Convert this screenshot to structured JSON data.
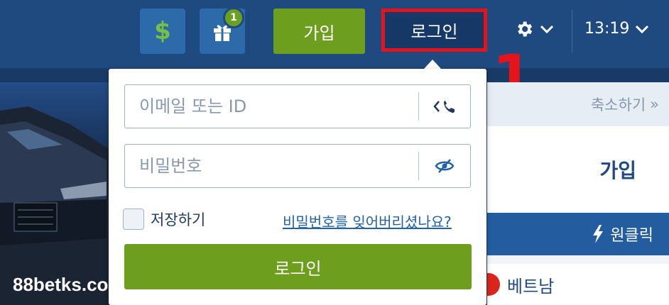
{
  "header": {
    "gift_badge_count": "1",
    "join_label": "가입",
    "login_label": "로그인",
    "time": "13:19",
    "annotation_marker": "1"
  },
  "login_form": {
    "email_placeholder": "이메일 또는 ID",
    "email_value": "",
    "password_placeholder": "비밀번호",
    "password_value": "",
    "remember_label": "저장하기",
    "remember_checked": false,
    "forgot_label": "비밀번호를 잊어버리셨나요?",
    "submit_label": "로그인"
  },
  "side_panel": {
    "collapse_label": "축소하기",
    "join_heading": "가입",
    "oneclick_label": "원클릭",
    "country_label": "베트남"
  },
  "watermark": "88betks.com",
  "colors": {
    "header_bg": "#1f4a80",
    "accent_green": "#6e9e1e",
    "login_highlight": "#e3141b",
    "link_blue": "#2463a6"
  },
  "icons": {
    "dollar": "dollar-icon",
    "gift": "gift-icon",
    "gear": "gear-icon",
    "chevron": "chevron-down-icon",
    "phone_toggle": "phone-icon",
    "visibility": "eye-slash-icon",
    "bolt": "lightning-icon",
    "collapse_arrows": "double-chevron-right-icon"
  }
}
